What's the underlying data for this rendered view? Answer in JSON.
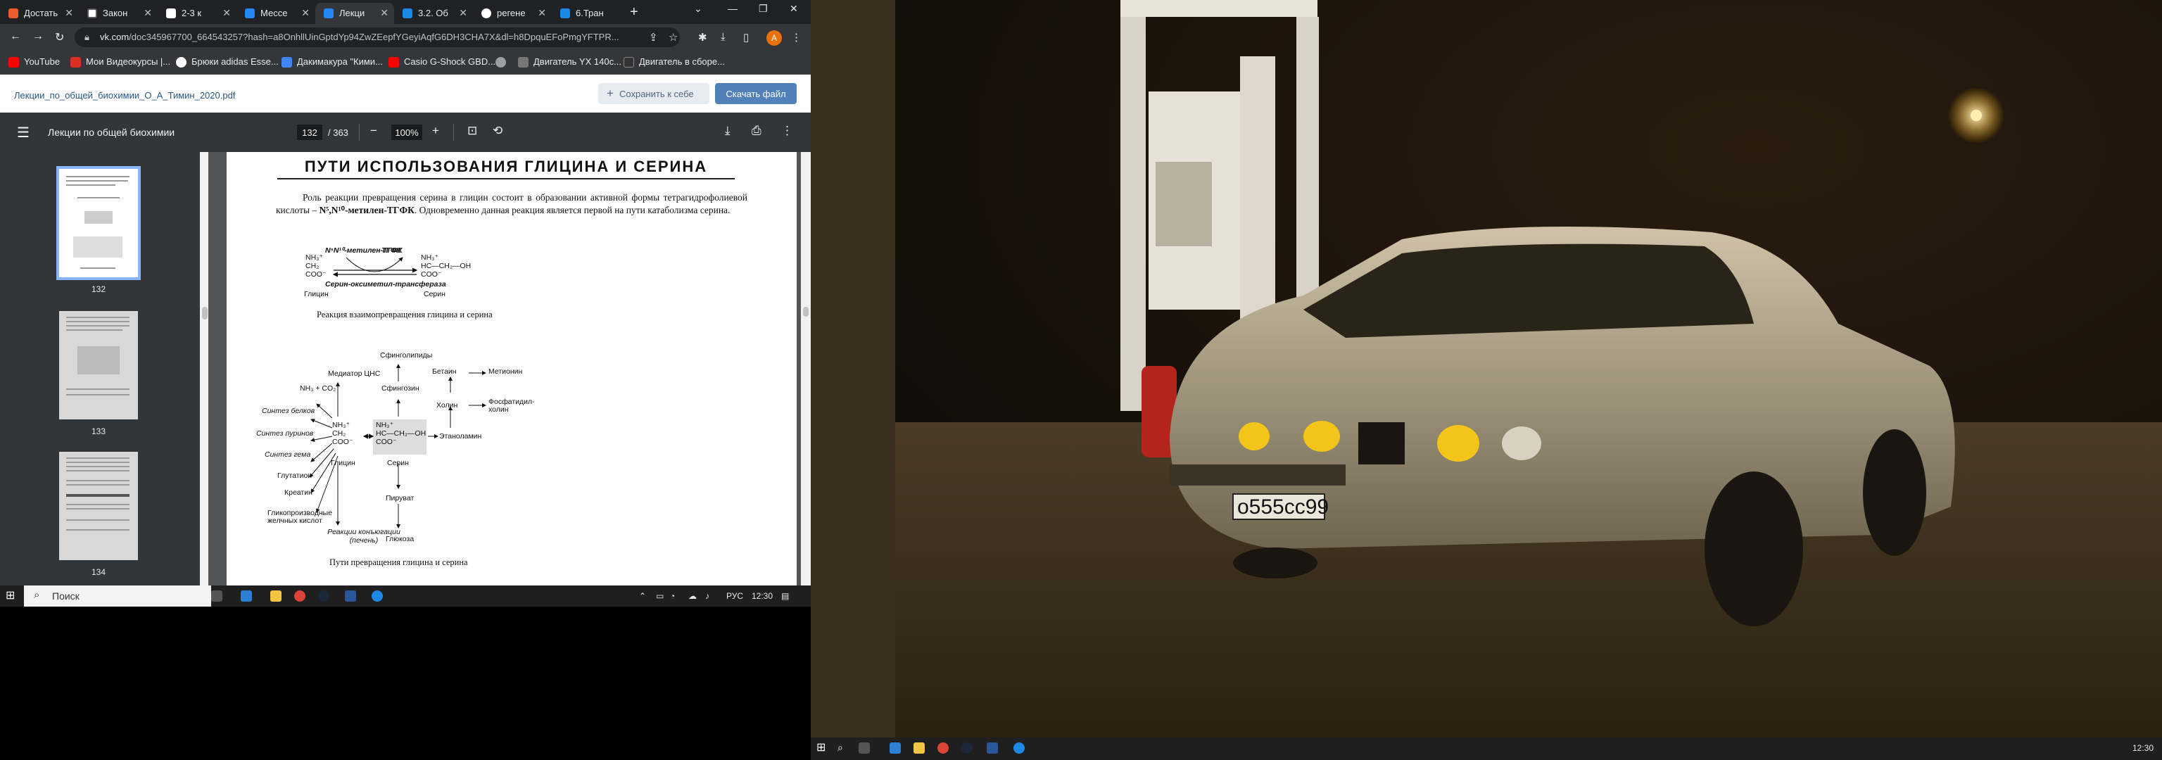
{
  "browser": {
    "tabs": [
      {
        "label": "Достать",
        "color": "#e85d2a"
      },
      {
        "label": "Закон",
        "color": "#ffffff"
      },
      {
        "label": "2-3 к",
        "color": "#ffffff"
      },
      {
        "label": "Мессе",
        "color": "#4a76a8"
      },
      {
        "label": "Лекци",
        "color": "#2787f5"
      },
      {
        "label": "3.2. Об",
        "color": "#1e88e5"
      },
      {
        "label": "регене",
        "color": "#ffffff"
      },
      {
        "label": "6.Тран",
        "color": "#1e88e5"
      }
    ],
    "url_host": "vk.com",
    "url_rest": "/doc345967700_664543257?hash=a8OnhllUinGptdYp94ZwZEepfYGeyiAqfG6DH3CHA7X&dl=h8DpquEFoPmgYFTPR...",
    "profile_initial": "А",
    "bookmarks": [
      {
        "label": "YouTube",
        "color": "#ff0000"
      },
      {
        "label": "Мои Видеокурсы |...",
        "color": "#d93025"
      },
      {
        "label": "Брюки adidas Esse...",
        "color": "#ffffff"
      },
      {
        "label": "Дакимакура \"Кими...",
        "color": "#4285f4"
      },
      {
        "label": "Casio G-Shock GBD...",
        "color": "#ff0000"
      },
      {
        "label": "",
        "color": "#9aa0a6"
      },
      {
        "label": "Двигатель YX 140c...",
        "color": "#777777"
      },
      {
        "label": "Двигатель в сборе...",
        "color": "#333333"
      }
    ]
  },
  "vk": {
    "doc_name": "Лекции_по_общей_биохимии_О_А_Тимин_2020.pdf",
    "save_label": "Сохранить к себе",
    "download_label": "Скачать файл"
  },
  "pdf": {
    "title": "Лекции по общей биохимии",
    "page_current": "132",
    "page_total": "/ 363",
    "zoom": "100%",
    "thumbnails": [
      "132",
      "133",
      "134"
    ],
    "page": {
      "heading": "ПУТИ ИСПОЛЬЗОВАНИЯ ГЛИЦИНА И СЕРИНА",
      "paragraph_1": "Роль реакции превращения серина в глицин состоит в образовании активной формы тетрагидрофолиевой кислоты – ",
      "paragraph_bold": "N⁵,N¹⁰-метилен-ТГФК",
      "paragraph_2": ". Одновременно данная реакция является первой на пути катаболизма серина.",
      "reaction": {
        "top_left": "N⁵N¹⁰-метилен-ТГФК",
        "top_right": "ТГФК",
        "enzyme": "Серин-оксиметил-трансфераза",
        "left_label": "Глицин",
        "right_label": "Серин",
        "caption": "Реакция взаимопревращения глицина и серина"
      },
      "pathways": {
        "glycine_products": [
          "NH₃ + CO₂",
          "Медиатор ЦНС",
          "Синтез белков",
          "Синтез пуринов",
          "Синтез гема",
          "Глутатион",
          "Креатин",
          "Гликопроизводные желчных кислот",
          "Реакции конъюгации (печень)"
        ],
        "serine_products": [
          "Сфинголипиды",
          "Сфингозин",
          "Этаноламин",
          "Пируват",
          "Глюкоза"
        ],
        "choline_branch": [
          "Бетаин",
          "Метионин",
          "Холин",
          "Фосфатидил-холин"
        ],
        "glycine_label": "Глицин",
        "serine_label": "Серин",
        "caption": "Пути превращения глицина и серина"
      }
    }
  },
  "taskbar": {
    "search_placeholder": "Поиск",
    "language": "РУС",
    "time": "12:30"
  },
  "photo": {
    "plate": "о555сс99"
  }
}
